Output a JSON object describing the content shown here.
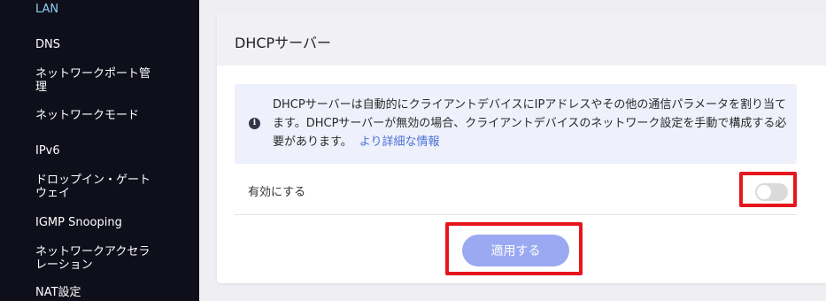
{
  "sidebar": {
    "items": [
      {
        "label": "LAN",
        "active": true
      },
      {
        "label": "DNS"
      },
      {
        "label": "ネットワークポート管理"
      },
      {
        "label": "ネットワークモード"
      },
      {
        "label": "IPv6"
      },
      {
        "label": "ドロップイン・ゲートウェイ"
      },
      {
        "label": "IGMP Snooping"
      },
      {
        "label": "ネットワークアクセラレーション"
      },
      {
        "label": "NAT設定"
      }
    ]
  },
  "panel": {
    "title": "DHCPサーバー",
    "info": {
      "icon": "info-icon",
      "text": "DHCPサーバーは自動的にクライアントデバイスにIPアドレスやその他の通信パラメータを割り当てます。DHCPサーバーが無効の場合、クライアントデバイスのネットワーク設定を手動で構成する必要があります。",
      "link": "より詳細な情報"
    },
    "enable_label": "有効にする",
    "enable_state": false,
    "apply_label": "適用する"
  },
  "colors": {
    "sidebar_bg": "#0f0f1c",
    "active_nav": "#8fd0f5",
    "apply_button": "#9aa9f1",
    "highlight": "#e6161c",
    "link": "#4a6fd6"
  }
}
